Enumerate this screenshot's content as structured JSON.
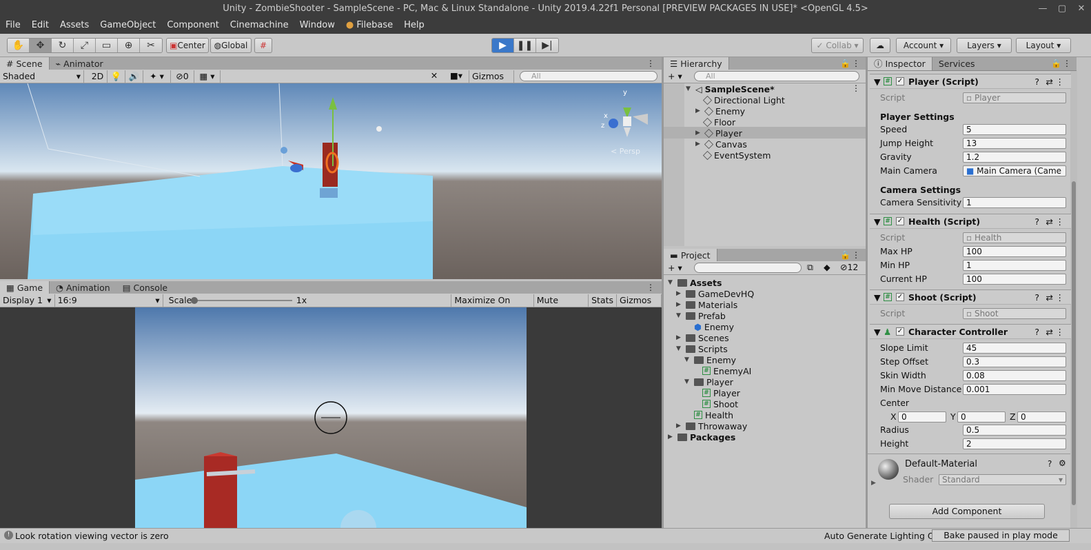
{
  "window": {
    "title": "Unity - ZombieShooter - SampleScene - PC, Mac & Linux Standalone - Unity 2019.4.22f1 Personal [PREVIEW PACKAGES IN USE]* <OpenGL 4.5>"
  },
  "menu": [
    "File",
    "Edit",
    "Assets",
    "GameObject",
    "Component",
    "Cinemachine",
    "Window",
    "Filebase",
    "Help"
  ],
  "toolbar": {
    "center": "Center",
    "global": "Global",
    "collab": "Collab",
    "account": "Account",
    "layers": "Layers",
    "layout": "Layout"
  },
  "scene": {
    "tabs": [
      "Scene",
      "Animator"
    ],
    "shading": "Shaded",
    "mode2d": "2D",
    "hidden_count": "0",
    "gizmos": "Gizmos",
    "search_placeholder": "All",
    "persp": "Persp"
  },
  "game": {
    "tabs": [
      "Game",
      "Animation",
      "Console"
    ],
    "display": "Display 1",
    "aspect": "16:9",
    "scale_label": "Scale",
    "scale_value": "1x",
    "maximize": "Maximize On Play",
    "mute": "Mute Audio",
    "stats": "Stats",
    "gizmos": "Gizmos"
  },
  "hierarchy": {
    "tab": "Hierarchy",
    "search_placeholder": "All",
    "scene": "SampleScene*",
    "items": [
      "Directional Light",
      "Enemy",
      "Floor",
      "Player",
      "Canvas",
      "EventSystem"
    ]
  },
  "project": {
    "tab": "Project",
    "hidden_count": "12",
    "items": [
      "Assets",
      "GameDevHQ",
      "Materials",
      "Prefab",
      "Enemy",
      "Scenes",
      "Scripts",
      "Enemy",
      "EnemyAI",
      "Player",
      "Player",
      "Shoot",
      "Health",
      "Throwaway",
      "Packages"
    ]
  },
  "inspector": {
    "tabs": [
      "Inspector",
      "Services"
    ],
    "player": {
      "title": "Player (Script)",
      "script_label": "Script",
      "script": "Player",
      "section1": "Player Settings",
      "speed_label": "Speed",
      "speed": "5",
      "jump_label": "Jump Height",
      "jump": "13",
      "gravity_label": "Gravity",
      "gravity": "1.2",
      "camera_label": "Main Camera",
      "camera": "Main Camera (Came",
      "section2": "Camera Settings",
      "sens_label": "Camera Sensitivity",
      "sens": "1"
    },
    "health": {
      "title": "Health (Script)",
      "script_label": "Script",
      "script": "Health",
      "max_label": "Max HP",
      "max": "100",
      "min_label": "Min HP",
      "min": "1",
      "cur_label": "Current HP",
      "cur": "100"
    },
    "shoot": {
      "title": "Shoot (Script)",
      "script_label": "Script",
      "script": "Shoot"
    },
    "cc": {
      "title": "Character Controller",
      "slope_label": "Slope Limit",
      "slope": "45",
      "step_label": "Step Offset",
      "step": "0.3",
      "skin_label": "Skin Width",
      "skin": "0.08",
      "minmove_label": "Min Move Distance",
      "minmove": "0.001",
      "center_label": "Center",
      "x_label": "X",
      "x": "0",
      "y_label": "Y",
      "y": "0",
      "z_label": "Z",
      "z": "0",
      "radius_label": "Radius",
      "radius": "0.5",
      "height_label": "Height",
      "height": "2"
    },
    "material": {
      "name": "Default-Material",
      "shader_label": "Shader",
      "shader": "Standard"
    },
    "add_component": "Add Component"
  },
  "status": {
    "message": "Look rotation viewing vector is zero",
    "lighting": "Auto Generate Lighting Off",
    "bake": "Bake paused in play mode"
  }
}
